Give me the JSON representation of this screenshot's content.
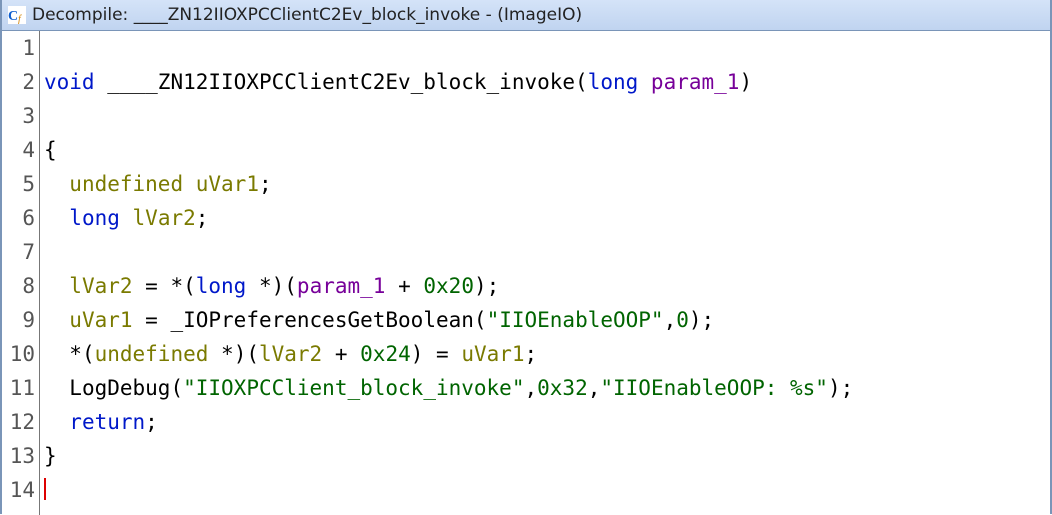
{
  "title": {
    "prefix": "Decompile: ",
    "function_name": "____ZN12IIOXPCClientC2Ev_block_invoke",
    "suffix": " -  (ImageIO)",
    "icon": "decompile-icon"
  },
  "gutter": [
    "1",
    "2",
    "3",
    "4",
    "5",
    "6",
    "7",
    "8",
    "9",
    "10",
    "11",
    "12",
    "13",
    "14"
  ],
  "code": {
    "l1": "",
    "void": "void",
    "fn_name": "____ZN12IIOXPCClientC2Ev_block_invoke",
    "long": "long",
    "param1": "param_1",
    "brace_open": "{",
    "undefined": "undefined",
    "uVar1_decl": "uVar1",
    "lVar2_decl": "lVar2",
    "lVar2": "lVar2",
    "deref_long": "long",
    "hex20": "0x20",
    "uVar1": "uVar1",
    "iopref": "_IOPreferencesGetBoolean",
    "str_enable": "\"IIOEnableOOP\"",
    "zero": "0",
    "hex24": "0x24",
    "logdbg": "LogDebug",
    "str_blk": "\"IIOXPCClient_block_invoke\"",
    "hex32": "0x32",
    "str_fmt": "\"IIOEnableOOP: %s\"",
    "return": "return",
    "brace_close": "}"
  }
}
